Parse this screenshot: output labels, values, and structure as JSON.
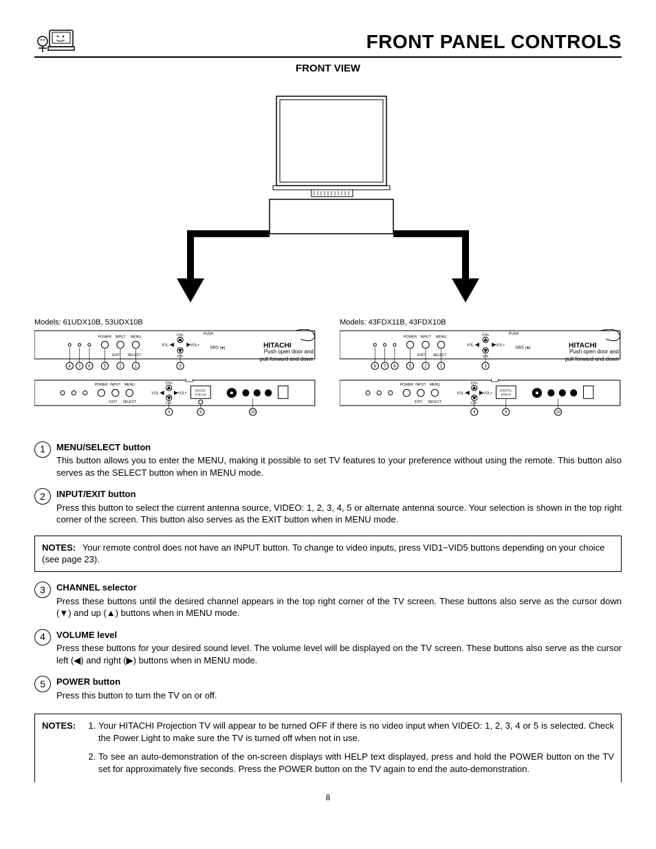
{
  "header": {
    "title": "FRONT PANEL CONTROLS",
    "subheading": "FRONT VIEW"
  },
  "panels": {
    "left_models": "Models:  61UDX10B, 53UDX10B",
    "right_models": "Models:  43FDX11B, 43FDX10B",
    "door_note_l1": "Push open door and",
    "door_note_l2": "pull forward and down",
    "brand": "HITACHI",
    "push_label": "PUSH",
    "top_labels": {
      "power": "POWER",
      "input": "INPUT",
      "menu": "MENU",
      "exit": "EXIT",
      "select": "SELECT",
      "vol_minus": "VOL-",
      "vol_plus": "VOL+",
      "ch_up": "CH+",
      "ch_dn": "CH-",
      "srs": "SRS"
    },
    "callouts": {
      "c1": "1",
      "c2": "2",
      "c3": "3",
      "c4": "4",
      "c5": "5",
      "c6": "6",
      "c7": "7",
      "c8": "8",
      "c9": "9",
      "c10": "10"
    },
    "left_extra": "MAGIC FOCUS",
    "right_extra": "DIGITAL ARRAY"
  },
  "items": [
    {
      "num": "1",
      "title": "MENU/SELECT button",
      "desc": "This button allows you to enter the MENU, making it possible to set TV features to your preference without using the remote.  This button also serves as the SELECT button when in MENU mode."
    },
    {
      "num": "2",
      "title": "INPUT/EXIT button",
      "desc": "Press this button to select the current antenna source, VIDEO: 1, 2, 3, 4, 5 or alternate antenna source.  Your selection is shown in the top right corner of the screen.  This button also serves as the EXIT button when in MENU mode."
    }
  ],
  "notes1": {
    "label": "NOTES:",
    "text": "Your remote control does not have an INPUT button.  To change to video inputs, press VID1~VID5 buttons depending on your choice (see page 23)."
  },
  "items2": [
    {
      "num": "3",
      "title": "CHANNEL selector",
      "desc": "Press these buttons until the desired channel appears in the top right corner of the TV screen.  These buttons also serve as the cursor down (▼) and up (▲) buttons when in MENU mode."
    },
    {
      "num": "4",
      "title": "VOLUME level",
      "desc": "Press these buttons for your desired sound level.  The volume level will be displayed on the TV screen.  These buttons also serve as the cursor left (◀) and right (▶) buttons when in MENU mode."
    },
    {
      "num": "5",
      "title": "POWER button",
      "desc": "Press this button to turn the TV on or off."
    }
  ],
  "notes2": {
    "label": "NOTES:",
    "items": [
      "Your HITACHI Projection TV will appear to be turned OFF if there is no video input when VIDEO: 1, 2, 3, 4 or 5 is selected.  Check the Power Light to make sure the TV is turned off when not in use.",
      "To see an auto-demonstration of the on-screen displays with HELP text displayed, press and hold the POWER button on the TV set for approximately five seconds.  Press the POWER button on the TV again to end the auto-demonstration."
    ]
  },
  "page_number": "8"
}
